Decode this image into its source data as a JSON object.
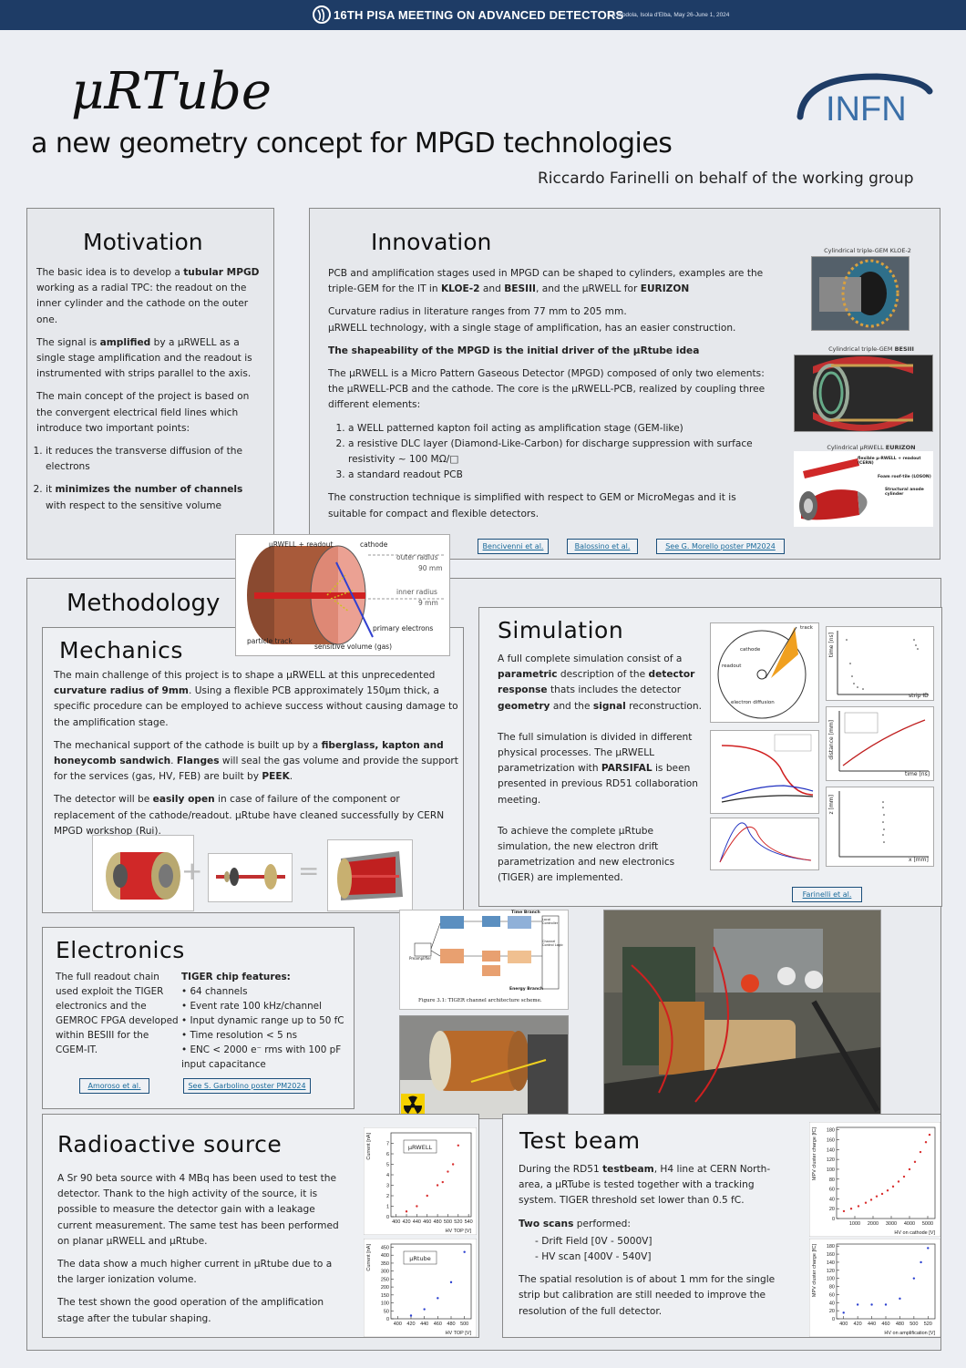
{
  "header": {
    "title": "16TH PISA MEETING ON ADVANCED DETECTORS",
    "subtitle": "La Biodola, Isola d'Elba, May 26-June 1, 2024"
  },
  "poster": {
    "title": "μRTube",
    "subtitle": "a new geometry concept for MPGD technologies",
    "author": "Riccardo Farinelli on behalf of the working group",
    "logo_text": "INFN"
  },
  "motivation": {
    "title": "Motivation",
    "p1_a": "The basic idea is to develop a ",
    "p1_b": "tubular MPGD",
    "p1_c": " working as a radial TPC: the readout on the inner cylinder and the cathode on the outer one.",
    "p2_a": "The signal is ",
    "p2_b": "amplified",
    "p2_c": " by a μRWELL as a single stage amplification and the readout is instrumented with strips parallel to the axis.",
    "p3": "The main concept of the project is based on the convergent electrical field lines which introduce two important points:",
    "item1": "it reduces the transverse diffusion of the electrons",
    "item2_a": "it ",
    "item2_b": "minimizes the number of channels",
    "item2_c": " with respect to the sensitive volume"
  },
  "innovation": {
    "title": "Innovation",
    "p1_a": "PCB and amplification stages used in MPGD can be shaped to cylinders, examples are the triple-GEM for the IT in ",
    "p1_b": "KLOE-2",
    "p1_c": " and ",
    "p1_d": "BESIII",
    "p1_e": ", and the μRWELL for ",
    "p1_f": "EURIZON",
    "p2": "Curvature radius in literature ranges from 77 mm to 205 mm.",
    "p3": "μRWELL technology, with a single stage of amplification, has an easier construction.",
    "p4": "The shapeability of the MPGD is the initial driver of the μRtube idea",
    "p5": "The μRWELL is a Micro Pattern Gaseous Detector (MPGD) composed of only two elements: the μRWELL-PCB and the cathode. The core is the μRWELL-PCB, realized by coupling three different elements:",
    "items": [
      "a WELL patterned kapton foil acting as amplification stage (GEM-like)",
      "a resistive DLC layer (Diamond-Like-Carbon) for discharge suppression with surface resistivity ~ 100 MΩ/□",
      "a standard readout PCB"
    ],
    "p6": "The construction technique is simplified with respect to GEM or MicroMegas and it is suitable for compact and flexible detectors.",
    "cap1": "Cylindrical triple-GEM KLOE-2",
    "cap2_a": "Cylindrical triple-GEM ",
    "cap2_b": "BESIII",
    "cap3_a": "Cylindrical μRWELL ",
    "cap3_b": "EURIZON",
    "eurizon_labels": [
      "flexible μ-RWELL + readout (CERN)",
      "Foam roof-tile (LOSON)",
      "Structural anode cylinder"
    ],
    "refs": [
      "Bencivenni et al.",
      "Balossino et al.",
      "See G. Morello poster PM2024"
    ]
  },
  "schematic": {
    "labels": [
      "μRWELL + readout",
      "cathode",
      "outer radius",
      "90 mm",
      "inner radius",
      "9 mm",
      "primary electrons",
      "particle track",
      "sensitive volume (gas)"
    ]
  },
  "methodology": {
    "title": "Methodology"
  },
  "mechanics": {
    "title": "Mechanics",
    "p1_a": "The main challenge of this project is to shape a μRWELL at this unprecedented ",
    "p1_b": "curvature radius of 9mm",
    "p1_c": ". Using a flexible PCB approximately 150μm thick, a specific procedure can be employed to achieve success without causing damage to the amplification stage.",
    "p2_a": "The mechanical support of the cathode is built up by a ",
    "p2_b": "fiberglass, kapton and honeycomb sandwich",
    "p2_c": ". ",
    "p2_d": "Flanges",
    "p2_e": " will seal the gas volume and provide the support for the services (gas, HV, FEB) are built by ",
    "p2_f": "PEEK",
    "p2_g": ".",
    "p3_a": "The detector will be ",
    "p3_b": "easily open",
    "p3_c": " in case of failure of the component or replacement of the cathode/readout. μRtube have cleaned successfully by CERN MPGD workshop (Rui).",
    "plus": "+",
    "equals": "="
  },
  "simulation": {
    "title": "Simulation",
    "p1_a": "A full complete simulation consist of a ",
    "p1_b": "parametric",
    "p1_c": " description of the ",
    "p1_d": "detector response",
    "p1_e": " thats includes the detector ",
    "p1_f": "geometry",
    "p1_g": " and the ",
    "p1_h": "signal",
    "p1_i": " reconstruction.",
    "p2_a": "The full simulation is divided in different physical processes. The μRWELL parametrization with ",
    "p2_b": "PARSIFAL",
    "p2_c": " is been presented in previous RD51 collaboration meeting.",
    "p3": "To achieve the complete μRtube simulation, the new electron drift parametrization and new electronics (TIGER) are implemented.",
    "diagram_labels": [
      "track",
      "cathode",
      "readout",
      "electron diffusion"
    ],
    "plot_labels": [
      "time [ns]",
      "strip ID",
      "distance [mm]",
      "time [ns]",
      "z [mm]",
      "x [mm]"
    ],
    "ref": "Farinelli et al."
  },
  "electronics": {
    "title": "Electronics",
    "p1": "The full readout chain used exploit the TIGER electronics and the GEMROC FPGA developed within BESIII for the CGEM-IT.",
    "features_title": "TIGER chip features:",
    "features": [
      "64 channels",
      "Event rate 100 kHz/channel",
      "Input dynamic range up to 50 fC",
      "Time resolution < 5 ns",
      "ENC < 2000 e⁻ rms with 100 pF input capacitance"
    ],
    "refs": [
      "Amoroso et al.",
      "See S. Garbolino poster PM2024"
    ],
    "figure_caption": "Figure 3.1: TIGER channel architecture scheme.",
    "diagram_labels": [
      "Time Branch",
      "Energy Branch",
      "Preamplifier",
      "Channel Control Logic",
      "Local Controller"
    ]
  },
  "radioactive": {
    "title": "Radioactive source",
    "p1": "A Sr 90 beta source with 4 MBq has been used to test the detector. Thank to the high activity of the source, it is possible to measure the detector gain with a leakage current measurement. The same test has been performed on planar μRWELL and μRtube.",
    "p2": "The data show a much higher current in μRtube due to a the larger ionization volume.",
    "p3": "The test shown the good operation of the amplification stage after the tubular shaping."
  },
  "testbeam": {
    "title": "Test beam",
    "p1_a": "During the RD51 ",
    "p1_b": "testbeam",
    "p1_c": ", H4 line at CERN North-area, a  μRTube is tested together with a tracking system. TIGER threshold set lower than 0.5 fC.",
    "scans_title": "Two scans",
    "scans_rest": " performed:",
    "scans": [
      "Drift Field [0V - 5000V]",
      "HV scan [400V - 540V]"
    ],
    "p2": "The spatial resolution is of about 1 mm for the single strip but calibration are still needed to improve the resolution of the full detector."
  },
  "chart_data": [
    {
      "type": "scatter",
      "title": "μRWELL",
      "xlabel": "HV TOP [V]",
      "ylabel": "Current [nA]",
      "xlim": [
        390,
        545
      ],
      "ylim": [
        0,
        8
      ],
      "x": [
        420,
        440,
        460,
        480,
        490,
        500,
        510,
        520
      ],
      "y": [
        0.5,
        1.0,
        2.0,
        3.0,
        3.3,
        4.3,
        5.0,
        6.8
      ],
      "xticks": [
        400,
        420,
        440,
        460,
        480,
        500,
        520,
        540
      ],
      "yticks": [
        0,
        1,
        2,
        3,
        4,
        5,
        6,
        7
      ],
      "color": "#d93030"
    },
    {
      "type": "scatter",
      "title": "μRtube",
      "xlabel": "HV TOP [V]",
      "ylabel": "Current [nA]",
      "xlim": [
        390,
        510
      ],
      "ylim": [
        0,
        470
      ],
      "x": [
        420,
        440,
        460,
        480,
        500
      ],
      "y": [
        20,
        60,
        130,
        230,
        420
      ],
      "xticks": [
        400,
        420,
        440,
        460,
        480,
        500
      ],
      "yticks": [
        0,
        50,
        100,
        150,
        200,
        250,
        300,
        350,
        400,
        450
      ],
      "color": "#2a3fd0"
    },
    {
      "type": "scatter",
      "title": "",
      "xlabel": "HV on cathode [V]",
      "ylabel": "MPV cluster charge [fC]",
      "xlim": [
        0,
        5400
      ],
      "ylim": [
        0,
        185
      ],
      "x": [
        400,
        800,
        1200,
        1600,
        1900,
        2200,
        2500,
        2800,
        3100,
        3400,
        3700,
        4000,
        4300,
        4600,
        4900,
        5100
      ],
      "y": [
        15,
        20,
        25,
        32,
        38,
        45,
        50,
        57,
        65,
        75,
        85,
        100,
        115,
        135,
        155,
        170
      ],
      "xticks": [
        1000,
        2000,
        3000,
        4000,
        5000
      ],
      "yticks": [
        0,
        20,
        40,
        60,
        80,
        100,
        120,
        140,
        160,
        180
      ],
      "color": "#d93030"
    },
    {
      "type": "scatter",
      "title": "",
      "xlabel": "HV on amplification [V]",
      "ylabel": "MPV cluster charge [fC]",
      "xlim": [
        390,
        530
      ],
      "ylim": [
        0,
        185
      ],
      "x": [
        400,
        420,
        440,
        460,
        480,
        500,
        510,
        520
      ],
      "y": [
        15,
        35,
        35,
        35,
        50,
        100,
        140,
        175
      ],
      "xticks": [
        400,
        420,
        440,
        460,
        480,
        500,
        520
      ],
      "yticks": [
        0,
        20,
        40,
        60,
        80,
        100,
        120,
        140,
        160,
        180
      ],
      "color": "#2a3fd0"
    }
  ]
}
